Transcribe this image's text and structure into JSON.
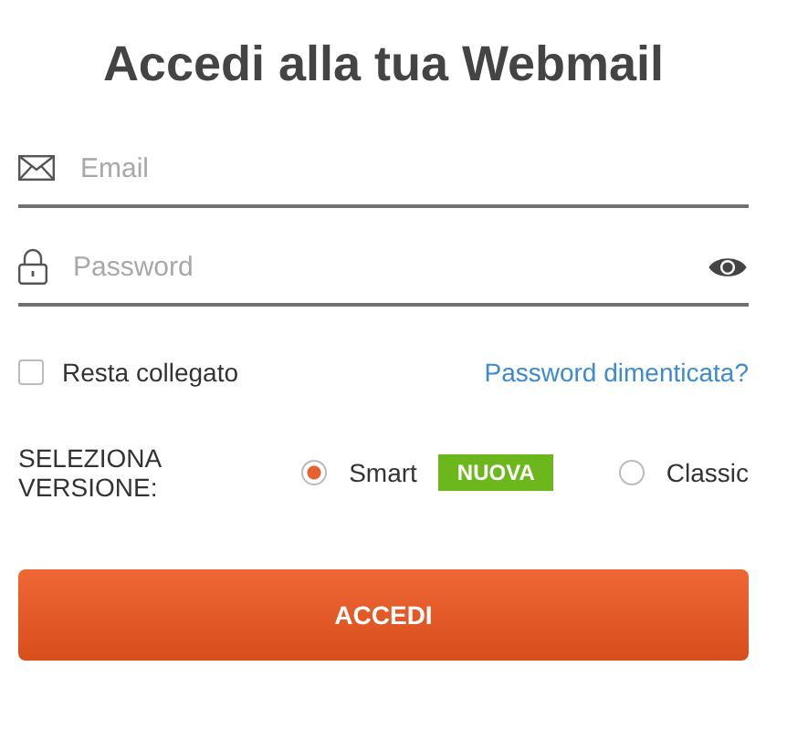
{
  "title": "Accedi alla tua Webmail",
  "email": {
    "placeholder": "Email"
  },
  "password": {
    "placeholder": "Password"
  },
  "remember": {
    "label": "Resta collegato",
    "checked": false
  },
  "forgot_link": "Password dimenticata?",
  "version": {
    "label": "SELEZIONA VERSIONE:",
    "options": [
      {
        "label": "Smart",
        "badge": "NUOVA",
        "selected": true
      },
      {
        "label": "Classic",
        "selected": false
      }
    ]
  },
  "submit": "ACCEDI"
}
